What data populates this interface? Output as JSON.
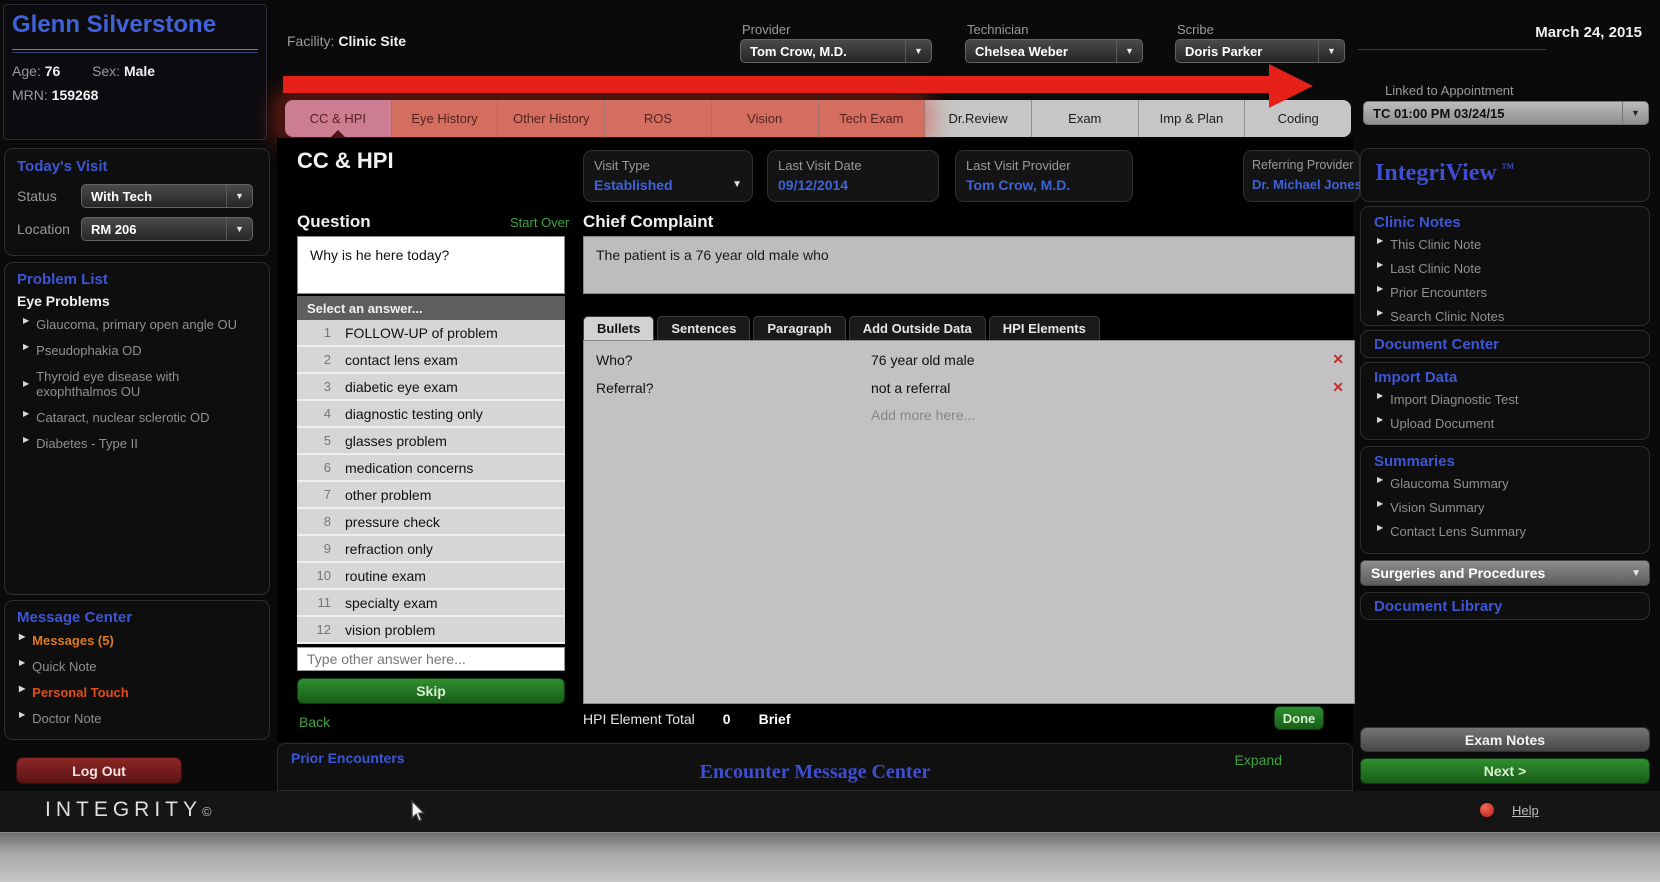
{
  "colors": {
    "accent_blue": "#3d56d6",
    "link_green": "#3fa33f",
    "alert_orange": "#e07a1a",
    "alert_red_orange": "#e04d1a",
    "annotation_red": "#e62119",
    "remove_red": "#cc2a2a"
  },
  "patient": {
    "name": "Glenn Silverstone",
    "age_label": "Age:",
    "age": "76",
    "sex_label": "Sex:",
    "sex": "Male",
    "mrn_label": "MRN:",
    "mrn": "159268"
  },
  "header": {
    "facility_label": "Facility:",
    "facility": "Clinic Site",
    "provider_label": "Provider",
    "provider": "Tom Crow, M.D.",
    "technician_label": "Technician",
    "technician": "Chelsea Weber",
    "scribe_label": "Scribe",
    "scribe": "Doris Parker",
    "date": "March 24, 2015",
    "linked_label": "Linked to Appointment",
    "linked_value": "TC 01:00 PM 03/24/15"
  },
  "tabs": [
    {
      "label": "CC & HPI"
    },
    {
      "label": "Eye History"
    },
    {
      "label": "Other History"
    },
    {
      "label": "ROS"
    },
    {
      "label": "Vision"
    },
    {
      "label": "Tech Exam"
    },
    {
      "label": "Dr.Review"
    },
    {
      "label": "Exam"
    },
    {
      "label": "Imp & Plan"
    },
    {
      "label": "Coding"
    }
  ],
  "sidebar_left": {
    "todays_visit": {
      "title": "Today's Visit",
      "status_label": "Status",
      "status": "With Tech",
      "location_label": "Location",
      "location": "RM 206"
    },
    "problem_list": {
      "title": "Problem List",
      "group": "Eye Problems",
      "items": [
        "Glaucoma, primary open angle OU",
        "Pseudophakia OD",
        "Thyroid eye disease with exophthalmos OU",
        "Cataract, nuclear sclerotic OD",
        "Diabetes - Type II"
      ]
    },
    "message_center": {
      "title": "Message Center",
      "messages": "Messages (5)",
      "quick_note": "Quick Note",
      "personal_touch": "Personal Touch",
      "doctor_note": "Doctor Note"
    },
    "logout_label": "Log Out"
  },
  "main": {
    "title": "CC & HPI",
    "visit_cards": [
      {
        "label": "Visit Type",
        "value": "Established"
      },
      {
        "label": "Last Visit Date",
        "value": "09/12/2014"
      },
      {
        "label": "Last Visit Provider",
        "value": "Tom Crow, M.D."
      },
      {
        "label": "Referring Provider",
        "value": "Dr. Michael Jones"
      }
    ],
    "question_panel": {
      "title": "Question",
      "start_over": "Start Over",
      "question": "Why is he here today?",
      "select_prompt": "Select an answer...",
      "answers": [
        {
          "n": "1",
          "label": "FOLLOW-UP of problem"
        },
        {
          "n": "2",
          "label": "contact lens exam"
        },
        {
          "n": "3",
          "label": "diabetic eye exam"
        },
        {
          "n": "4",
          "label": "diagnostic testing only"
        },
        {
          "n": "5",
          "label": "glasses problem"
        },
        {
          "n": "6",
          "label": "medication concerns"
        },
        {
          "n": "7",
          "label": "other problem"
        },
        {
          "n": "8",
          "label": "pressure check"
        },
        {
          "n": "9",
          "label": "refraction only"
        },
        {
          "n": "10",
          "label": "routine exam"
        },
        {
          "n": "11",
          "label": "specialty exam"
        },
        {
          "n": "12",
          "label": "vision problem"
        }
      ],
      "other_placeholder": "Type other answer here...",
      "skip": "Skip",
      "back": "Back"
    },
    "chief_complaint": {
      "title": "Chief Complaint",
      "text": "The patient is a 76 year old male who",
      "tabs": [
        {
          "label": "Bullets"
        },
        {
          "label": "Sentences"
        },
        {
          "label": "Paragraph"
        },
        {
          "label": "Add Outside Data"
        },
        {
          "label": "HPI Elements"
        }
      ],
      "entries": [
        {
          "q": "Who?",
          "a": "76 year old male"
        },
        {
          "q": "Referral?",
          "a": "not a referral"
        }
      ],
      "add_more": "Add more here...",
      "total_label": "HPI Element Total",
      "total": "0",
      "level": "Brief",
      "done": "Done"
    }
  },
  "sidebar_right": {
    "brand": "IntegriView",
    "tm": "™",
    "clinic_notes": {
      "title": "Clinic Notes",
      "items": [
        "This Clinic Note",
        "Last Clinic Note",
        "Prior Encounters",
        "Search Clinic Notes"
      ]
    },
    "document_center": "Document Center",
    "import_data": {
      "title": "Import Data",
      "items": [
        "Import Diagnostic Test",
        "Upload Document"
      ]
    },
    "summaries": {
      "title": "Summaries",
      "items": [
        "Glaucoma Summary",
        "Vision Summary",
        "Contact Lens Summary"
      ]
    },
    "surgeries_bar": "Surgeries and Procedures",
    "document_library": "Document Library",
    "exam_notes": "Exam Notes",
    "next": "Next >"
  },
  "footer": {
    "prior_encounters": "Prior Encounters",
    "message_center_title": "Encounter Message Center",
    "expand": "Expand",
    "logo": "INTEGRITY",
    "copyright": "©",
    "help": "Help"
  }
}
